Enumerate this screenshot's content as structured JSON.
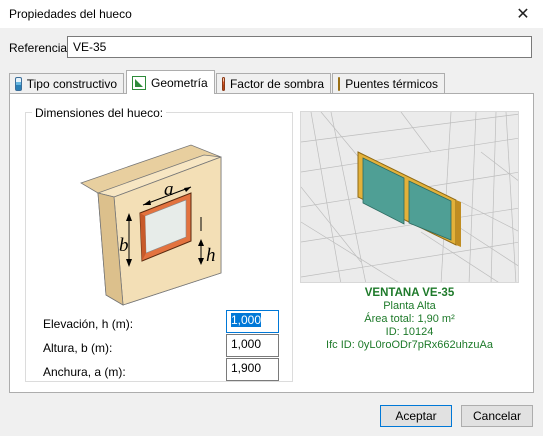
{
  "window": {
    "title": "Propiedades del hueco",
    "close_glyph": "✕"
  },
  "referencia": {
    "label": "Referencia:",
    "value": "VE-35"
  },
  "tabs": [
    {
      "label": "Tipo constructivo",
      "icon": "construction-type-icon"
    },
    {
      "label": "Geometría",
      "icon": "geometry-icon"
    },
    {
      "label": "Factor de sombra",
      "icon": "shade-factor-icon"
    },
    {
      "label": "Puentes térmicos",
      "icon": "thermal-bridge-icon"
    }
  ],
  "active_tab": "Geometría",
  "dimensiones": {
    "title": "Dimensiones del hueco:",
    "diagram_labels": {
      "a": "a",
      "b": "b",
      "h": "h"
    },
    "fields": [
      {
        "label": "Elevación, h (m):",
        "value": "1,000"
      },
      {
        "label": "Altura, b (m):",
        "value": "1,000"
      },
      {
        "label": "Anchura, a (m):",
        "value": "1,900"
      }
    ]
  },
  "element_info": {
    "name": "VENTANA VE-35",
    "planta": "Planta Alta",
    "area": "Área total: 1,90 m²",
    "id": "ID: 10124",
    "ifc_id": "Ifc ID: 0yL0roODr7pRx662uhzuAa"
  },
  "buttons": {
    "accept": "Aceptar",
    "cancel": "Cancelar"
  },
  "colors": {
    "accent": "#0078d7",
    "info_text": "#1e7a2a",
    "wall": "#f3dfb6",
    "glass": "#4f9f95",
    "frame": "#e8b23a"
  }
}
